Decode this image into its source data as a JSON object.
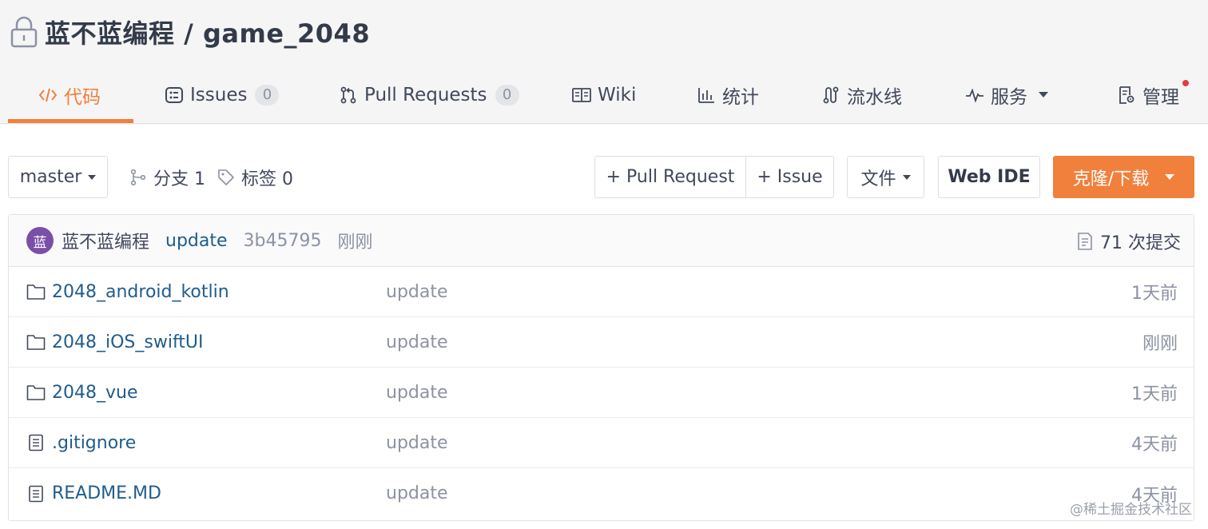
{
  "repo": {
    "title": "蓝不蓝编程 / game_2048"
  },
  "tabs": [
    {
      "label": "代码",
      "icon": "code-icon",
      "active": true
    },
    {
      "label": "Issues",
      "icon": "issues-icon",
      "badge": "0"
    },
    {
      "label": "Pull Requests",
      "icon": "pull-request-icon",
      "badge": "0"
    },
    {
      "label": "Wiki",
      "icon": "wiki-icon"
    },
    {
      "label": "统计",
      "icon": "stats-icon"
    },
    {
      "label": "流水线",
      "icon": "pipeline-icon"
    },
    {
      "label": "服务",
      "icon": "service-icon",
      "dropdown": true
    },
    {
      "label": "管理",
      "icon": "manage-icon",
      "notification_dot": true
    }
  ],
  "toolbar": {
    "branch": "master",
    "branches_label": "分支 1",
    "tags_label": "标签 0",
    "new_pr_label": "+ Pull Request",
    "new_issue_label": "+ Issue",
    "file_label": "文件",
    "web_ide_label": "Web IDE",
    "clone_label": "克隆/下载"
  },
  "commit": {
    "avatar_text": "蓝",
    "author": "蓝不蓝编程",
    "message": "update",
    "sha": "3b45795",
    "time": "刚刚",
    "count_label": "71 次提交"
  },
  "files": [
    {
      "name": "2048_android_kotlin",
      "type": "folder",
      "message": "update",
      "time": "1天前"
    },
    {
      "name": "2048_iOS_swiftUI",
      "type": "folder",
      "message": "update",
      "time": "刚刚"
    },
    {
      "name": "2048_vue",
      "type": "folder",
      "message": "update",
      "time": "1天前"
    },
    {
      "name": ".gitignore",
      "type": "file",
      "message": "update",
      "time": "4天前"
    },
    {
      "name": "README.MD",
      "type": "file",
      "message": "update",
      "time": "4天前"
    }
  ],
  "watermark": "@稀土掘金技术社区",
  "colors": {
    "accent": "#f0803c",
    "link": "#1f5c8c",
    "muted": "#8c92a4",
    "avatar": "#7b4fa8"
  }
}
